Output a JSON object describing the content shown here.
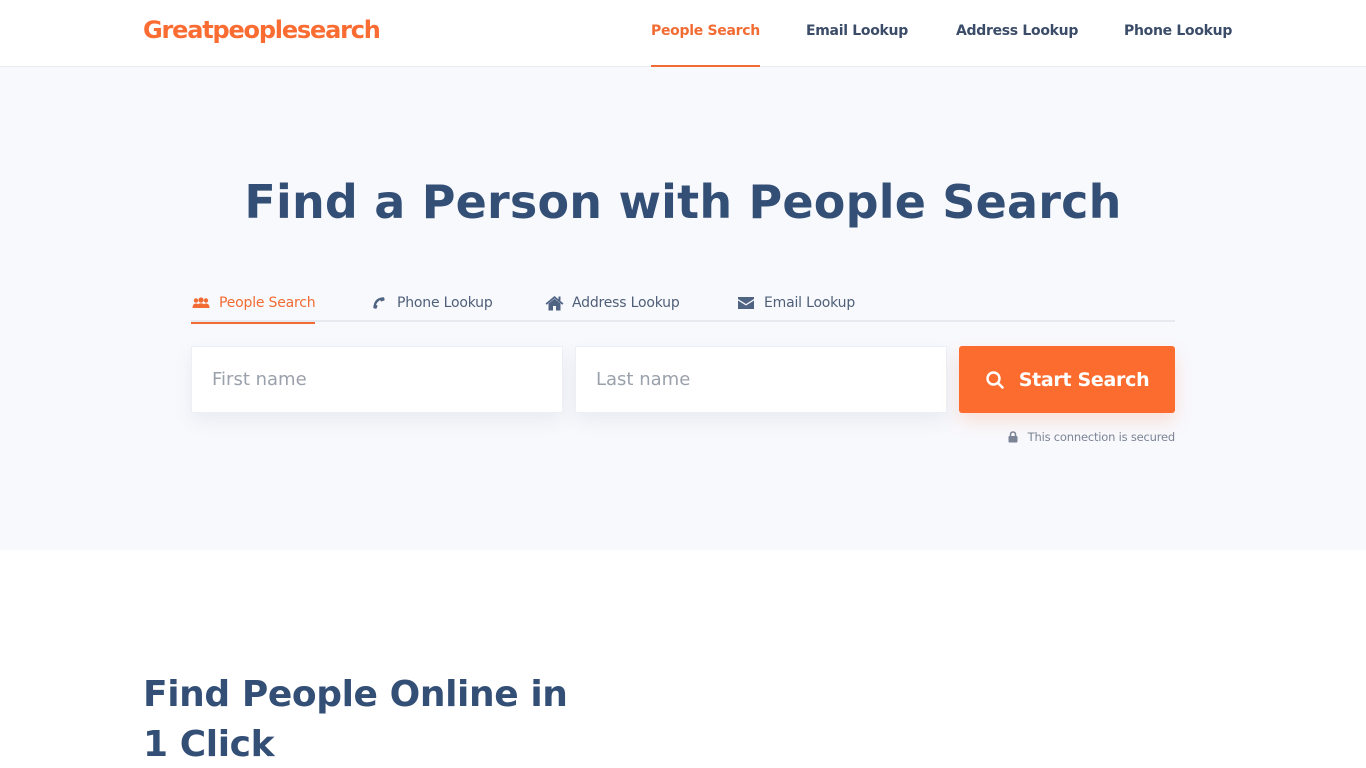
{
  "header": {
    "logo": "Greatpeoplesearch",
    "nav": [
      {
        "label": "People Search",
        "active": true
      },
      {
        "label": "Email Lookup",
        "active": false
      },
      {
        "label": "Address Lookup",
        "active": false
      },
      {
        "label": "Phone Lookup",
        "active": false
      }
    ]
  },
  "hero": {
    "title": "Find a Person with People Search",
    "tabs": [
      {
        "label": "People Search",
        "icon": "users-icon",
        "active": true
      },
      {
        "label": "Phone Lookup",
        "icon": "phone-icon",
        "active": false
      },
      {
        "label": "Address Lookup",
        "icon": "home-icon",
        "active": false
      },
      {
        "label": "Email Lookup",
        "icon": "envelope-icon",
        "active": false
      }
    ],
    "first_name": {
      "value": "",
      "placeholder": "First name"
    },
    "last_name": {
      "value": "",
      "placeholder": "Last name"
    },
    "search_button": "Start Search",
    "secure_note": "This connection is secured"
  },
  "section": {
    "title": "Find People Online in 1 Click"
  },
  "colors": {
    "accent": "#fd6c2f",
    "heading": "#344f76",
    "nav_text": "#3b4c69",
    "hero_bg": "#f8f9fd"
  }
}
